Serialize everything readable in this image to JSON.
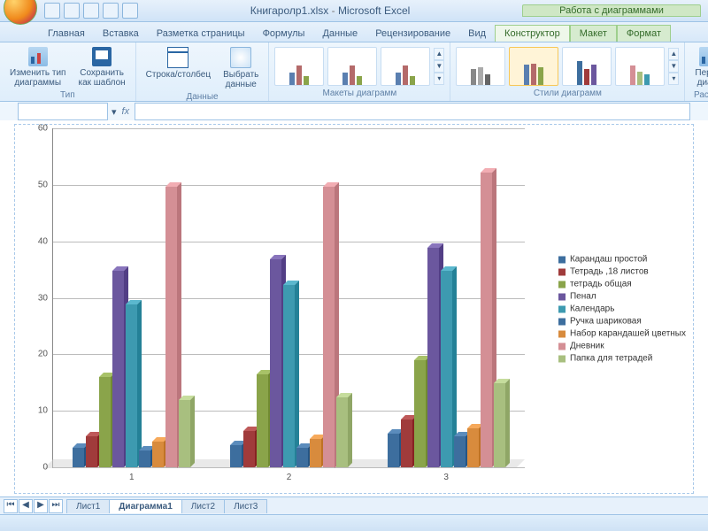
{
  "title": {
    "file": "Книгаролр1.xlsx",
    "app": "Microsoft Excel",
    "context": "Работа с диаграммами"
  },
  "qat_icons": [
    "save-icon",
    "undo-icon",
    "redo-icon",
    "print-icon",
    "open-icon"
  ],
  "tabs": {
    "core": [
      "Главная",
      "Вставка",
      "Разметка страницы",
      "Формулы",
      "Данные",
      "Рецензирование",
      "Вид"
    ],
    "context": [
      "Конструктор",
      "Макет",
      "Формат"
    ],
    "active": "Конструктор"
  },
  "ribbon": {
    "type_group": {
      "label": "Тип",
      "change": "Изменить тип\nдиаграммы",
      "save": "Сохранить\nкак шаблон"
    },
    "data_group": {
      "label": "Данные",
      "switch": "Строка/столбец",
      "select": "Выбрать\nданные"
    },
    "layout_group": {
      "label": "Макеты диаграмм"
    },
    "style_group": {
      "label": "Стили диаграмм"
    },
    "move_group": {
      "label": "Распол",
      "move": "Перем\nдиагр"
    }
  },
  "sheets": {
    "items": [
      "Лист1",
      "Диаграмма1",
      "Лист2",
      "Лист3"
    ],
    "active": "Диаграмма1"
  },
  "chart_data": {
    "type": "bar",
    "title": "",
    "xlabel": "",
    "ylabel": "",
    "ylim": [
      0,
      60
    ],
    "yticks": [
      0,
      10,
      20,
      30,
      40,
      50,
      60
    ],
    "categories": [
      "1",
      "2",
      "3"
    ],
    "series": [
      {
        "name": "Карандаш простой",
        "color": "#3d6e9e",
        "values": [
          3.5,
          4.0,
          6.0
        ]
      },
      {
        "name": "Тетрадь ,18 листов",
        "color": "#a03b3b",
        "values": [
          5.5,
          6.5,
          8.5
        ]
      },
      {
        "name": "тетрадь общая",
        "color": "#8aa44a",
        "values": [
          16.0,
          16.5,
          19.0
        ]
      },
      {
        "name": "Пенал",
        "color": "#6b579e",
        "values": [
          35.0,
          37.0,
          39.0
        ]
      },
      {
        "name": "Календарь",
        "color": "#3d9ab0",
        "values": [
          29.0,
          32.5,
          35.0
        ]
      },
      {
        "name": "Ручка шариковая",
        "color": "#3d6e9e",
        "values": [
          3.0,
          3.5,
          5.5
        ]
      },
      {
        "name": "Набор карандашей цветных",
        "color": "#d88b3d",
        "values": [
          4.5,
          5.0,
          7.0
        ]
      },
      {
        "name": "Дневник",
        "color": "#d48f95",
        "values": [
          50.0,
          50.0,
          52.5
        ]
      },
      {
        "name": "Папка для тетрадей",
        "color": "#a8bf7f",
        "values": [
          12.0,
          12.5,
          15.0
        ]
      }
    ]
  }
}
